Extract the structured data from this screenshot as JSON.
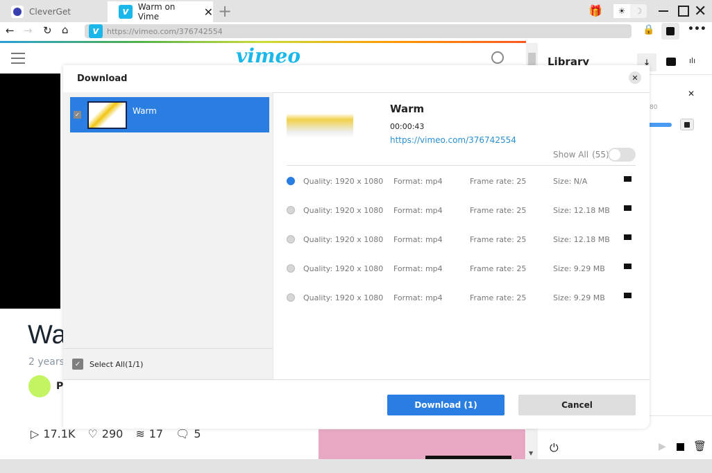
{
  "browser": {
    "tabs": [
      {
        "label": "CleverGet",
        "icon": "cleverget-logo"
      },
      {
        "label": "Warm on Vime",
        "icon": "vimeo-logo",
        "active": true
      }
    ],
    "new_tab": "+",
    "url": "https://vimeo.com/376742554",
    "theme": {
      "light": "☀",
      "dark": "☽"
    }
  },
  "vimeo": {
    "logo": "vimeo",
    "title_partial": "Wa",
    "age_partial": "2 years",
    "author_partial": "P",
    "stats": {
      "plays": "17.1K",
      "likes": "290",
      "collections": "17",
      "comments": "5"
    }
  },
  "library": {
    "title": "Library",
    "partial_text": "80"
  },
  "modal": {
    "title": "Download",
    "items": [
      {
        "label": "Warm",
        "checked": true
      }
    ],
    "select_all": "Select All(1/1)",
    "video": {
      "title": "Warm",
      "duration": "00:00:43",
      "url": "https://vimeo.com/376742554"
    },
    "show_all": "Show All",
    "show_all_count": "(55)",
    "show_all_on": false,
    "options": [
      {
        "quality": "Quality: 1920 x 1080",
        "format": "Format: mp4",
        "frame_rate": "Frame rate: 25",
        "size": "Size: N/A",
        "selected": true
      },
      {
        "quality": "Quality: 1920 x 1080",
        "format": "Format: mp4",
        "frame_rate": "Frame rate: 25",
        "size": "Size: 12.18 MB",
        "selected": false
      },
      {
        "quality": "Quality: 1920 x 1080",
        "format": "Format: mp4",
        "frame_rate": "Frame rate: 25",
        "size": "Size: 12.18 MB",
        "selected": false
      },
      {
        "quality": "Quality: 1920 x 1080",
        "format": "Format: mp4",
        "frame_rate": "Frame rate: 25",
        "size": "Size: 9.29 MB",
        "selected": false
      },
      {
        "quality": "Quality: 1920 x 1080",
        "format": "Format: mp4",
        "frame_rate": "Frame rate: 25",
        "size": "Size: 9.29 MB",
        "selected": false
      }
    ],
    "download_button": "Download (1)",
    "cancel_button": "Cancel"
  },
  "colors": {
    "accent": "#2a7de1",
    "vimeo": "#1ab7ea",
    "link": "#2a8fd0"
  }
}
